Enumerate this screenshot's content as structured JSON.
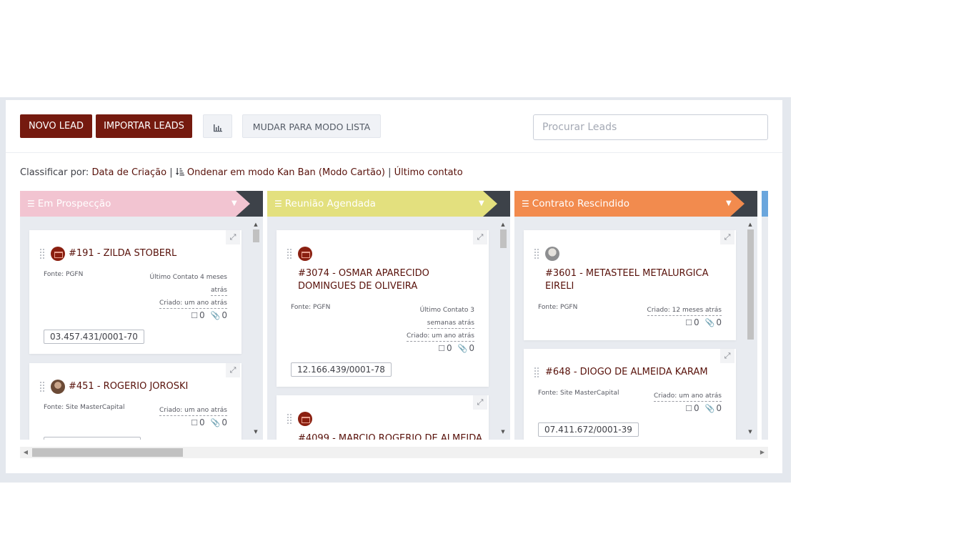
{
  "toolbar": {
    "new_lead": "NOVO LEAD",
    "import_leads": "IMPORTAR LEADS",
    "chart_icon": "bar-chart-icon",
    "list_mode": "MUDAR PARA MODO LISTA",
    "search_placeholder": "Procurar Leads"
  },
  "sort": {
    "label": "Classificar por:",
    "creation_date": "Data de Criação",
    "sep1": "|",
    "sort_icon": "sort-amount-icon",
    "kanban_order": "Ondenar em modo Kan Ban (Modo Cartão)",
    "sep2": "|",
    "last_contact": "Último contato"
  },
  "columns": [
    {
      "title": "Em Prospecção",
      "color": "#f2c4d1",
      "cards": [
        {
          "title": "#191 - ZILDA STOBERL",
          "source": "Fonte: PGFN",
          "last_contact_1": "Último Contato 4 meses",
          "last_contact_2": "atrás",
          "created": "Criado: um ano atrás",
          "notes": "0",
          "attachments": "0",
          "cnpj": "03.457.431/0001-70"
        },
        {
          "title": "#451 - ROGERIO JOROSKI",
          "source": "Fonte: Site MasterCapital",
          "created": "Criado: um ano atrás",
          "notes": "0",
          "attachments": "0"
        }
      ]
    },
    {
      "title": "Reunião Agendada",
      "color": "#e3e07e",
      "cards": [
        {
          "title_1": "#3074 - OSMAR APARECIDO",
          "title_2": "DOMINGUES DE OLIVEIRA",
          "source": "Fonte: PGFN",
          "last_contact_1": "Último Contato 3",
          "last_contact_2": "semanas atrás",
          "created": "Criado: um ano atrás",
          "notes": "0",
          "attachments": "0",
          "cnpj": "12.166.439/0001-78"
        },
        {
          "title": "#4099 - MARCIO ROGERIO DE ALMEIDA"
        }
      ]
    },
    {
      "title": "Contrato Rescindido",
      "color": "#f28b4e",
      "cards": [
        {
          "title_1": "#3601 - METASTEEL METALURGICA",
          "title_2": "EIRELI",
          "source": "Fonte: PGFN",
          "created": "Criado: 12 meses atrás",
          "notes": "0",
          "attachments": "0"
        },
        {
          "title": "#648 - DIOGO DE ALMEIDA KARAM",
          "source": "Fonte: Site MasterCapital",
          "created": "Criado: um ano atrás",
          "notes": "0",
          "attachments": "0",
          "cnpj": "07.411.672/0001-39"
        }
      ]
    },
    {
      "title": "",
      "color": "#6aa6dd"
    }
  ]
}
